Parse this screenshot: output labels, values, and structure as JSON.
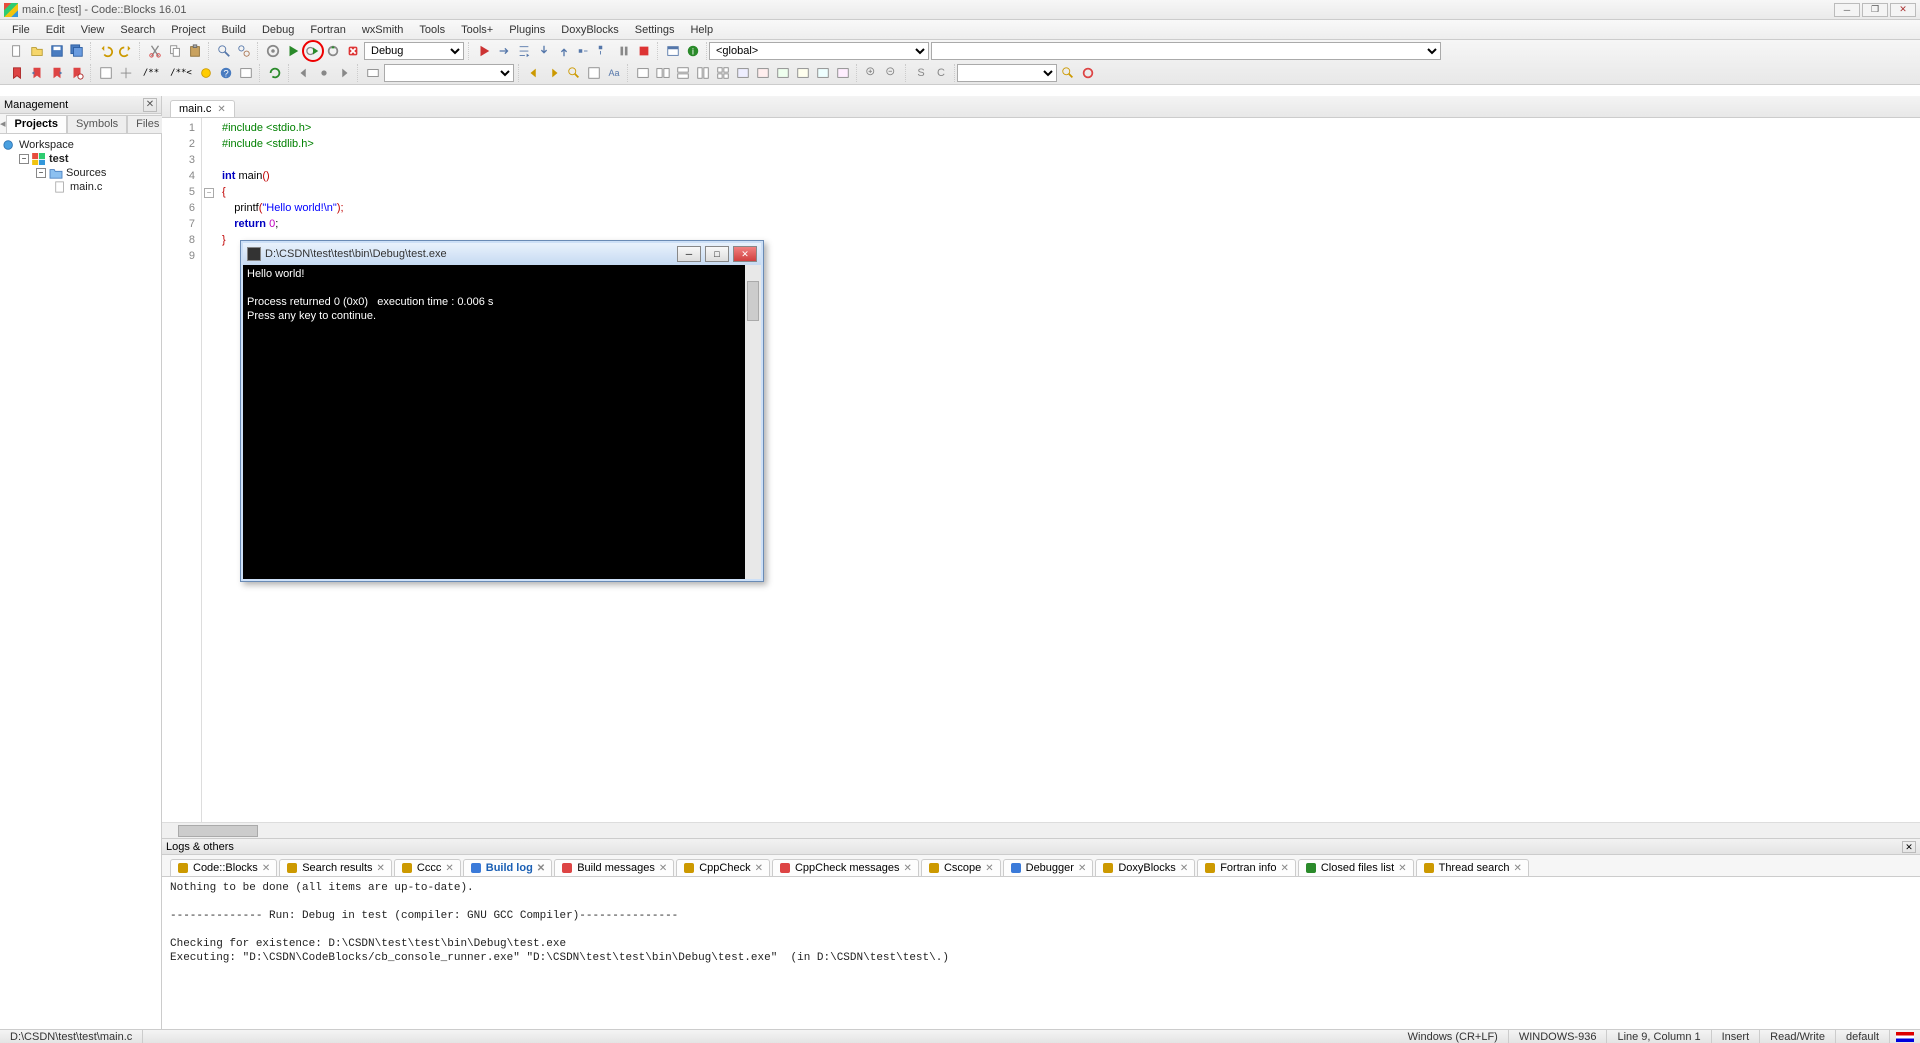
{
  "window": {
    "title": "main.c [test] - Code::Blocks 16.01"
  },
  "menus": [
    "File",
    "Edit",
    "View",
    "Search",
    "Project",
    "Build",
    "Debug",
    "Fortran",
    "wxSmith",
    "Tools",
    "Tools+",
    "Plugins",
    "DoxyBlocks",
    "Settings",
    "Help"
  ],
  "toolbar": {
    "build_target_label": "Debug",
    "scope_label": "<global>"
  },
  "mgmt": {
    "title": "Management",
    "tabs": {
      "active": "Projects",
      "others": [
        "Symbols",
        "Files"
      ]
    },
    "tree": {
      "workspace": "Workspace",
      "project": "test",
      "folder": "Sources",
      "file": "main.c"
    }
  },
  "editor": {
    "tab": "main.c",
    "lines": [
      "1",
      "2",
      "3",
      "4",
      "5",
      "6",
      "7",
      "8",
      "9"
    ],
    "code": {
      "l1a": "#include ",
      "l1b": "<stdio.h>",
      "l2a": "#include ",
      "l2b": "<stdlib.h>",
      "l4a": "int",
      "l4b": " main",
      "l4c": "()",
      "l5": "{",
      "l6a": "    printf",
      "l6b": "(",
      "l6c": "\"Hello world!\\n\"",
      "l6d": ");",
      "l7a": "    return ",
      "l7b": "0",
      "l7c": ";",
      "l8": "}"
    }
  },
  "console": {
    "title": "D:\\CSDN\\test\\test\\bin\\Debug\\test.exe",
    "line1": "Hello world!",
    "line2": "Process returned 0 (0x0)   execution time : 0.006 s",
    "line3": "Press any key to continue."
  },
  "logs": {
    "title": "Logs & others",
    "tabs": [
      "Code::Blocks",
      "Search results",
      "Cccc",
      "Build log",
      "Build messages",
      "CppCheck",
      "CppCheck messages",
      "Cscope",
      "Debugger",
      "DoxyBlocks",
      "Fortran info",
      "Closed files list",
      "Thread search"
    ],
    "active_tab_index": 3,
    "body": "Nothing to be done (all items are up-to-date).\n\n-------------- Run: Debug in test (compiler: GNU GCC Compiler)---------------\n\nChecking for existence: D:\\CSDN\\test\\test\\bin\\Debug\\test.exe\nExecuting: \"D:\\CSDN\\CodeBlocks/cb_console_runner.exe\" \"D:\\CSDN\\test\\test\\bin\\Debug\\test.exe\"  (in D:\\CSDN\\test\\test\\.)"
  },
  "status": {
    "path": "D:\\CSDN\\test\\test\\main.c",
    "eol": "Windows (CR+LF)",
    "encoding": "WINDOWS-936",
    "pos": "Line 9, Column 1",
    "mode": "Insert",
    "rw": "Read/Write",
    "profile": "default"
  }
}
